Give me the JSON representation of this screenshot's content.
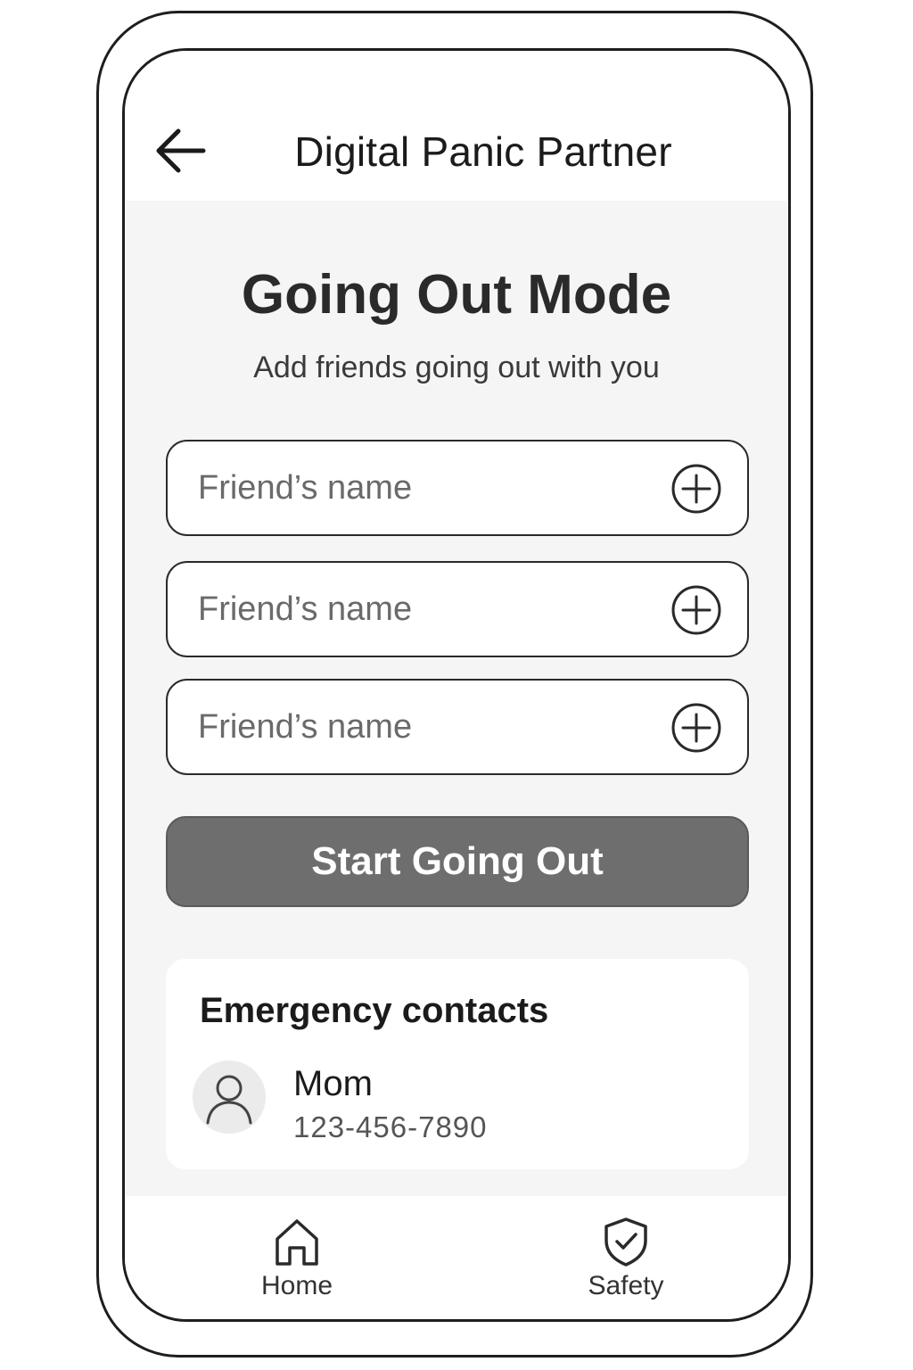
{
  "header": {
    "title": "Digital Panic Partner",
    "back_icon": "arrow-left-icon"
  },
  "main": {
    "heading": "Going Out Mode",
    "subheading": "Add friends going out with you",
    "friend_inputs": [
      {
        "placeholder": "Friend’s name",
        "value": "",
        "action_icon": "plus-circle-icon"
      },
      {
        "placeholder": "Friend’s name",
        "value": "",
        "action_icon": "plus-circle-icon"
      },
      {
        "placeholder": "Friend’s name",
        "value": "",
        "action_icon": "plus-circle-icon"
      }
    ],
    "start_button_label": "Start Going Out"
  },
  "emergency_contacts": {
    "title": "Emergency contacts",
    "contacts": [
      {
        "name": "Mom",
        "phone": "123-456-7890",
        "avatar_icon": "person-icon"
      }
    ]
  },
  "bottom_nav": {
    "items": [
      {
        "label": "Home",
        "icon": "home-icon"
      },
      {
        "label": "Safety",
        "icon": "shield-check-icon"
      }
    ]
  },
  "colors": {
    "background": "#f5f5f5",
    "surface": "#ffffff",
    "primary_button": "#6e6e6e",
    "text": "#1b1b1b",
    "outline": "#2a2a2a"
  }
}
